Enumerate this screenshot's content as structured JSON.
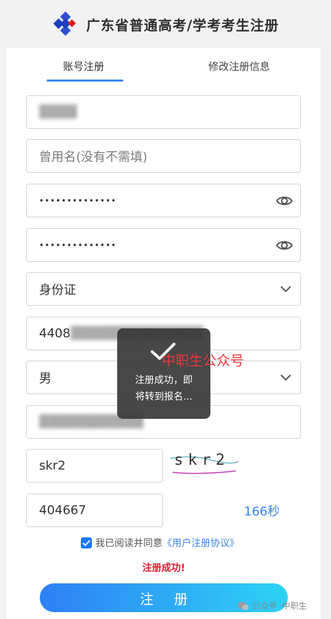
{
  "header": {
    "title": "广东省普通高考/学考考生注册"
  },
  "tabs": [
    {
      "label": "账号注册",
      "active": true
    },
    {
      "label": "修改注册信息",
      "active": false
    }
  ],
  "form": {
    "name_value": "▓▓▓▓",
    "former_name_placeholder": "曾用名(没有不需填)",
    "password_mask": "••••••••••••••",
    "confirm_password_mask": "••••••••••••••",
    "id_type": "身份证",
    "id_number_visible": "4408",
    "id_number_hidden": "▓▓▓▓▓▓▓▓▓▓▓▓▓▓",
    "gender": "男",
    "phone_hidden": "▓▓▓▓▓▓▓▓▓▓▓",
    "captcha_input": "skr2",
    "captcha_image_text": "skr2",
    "sms_code": "404667",
    "countdown": "166秒"
  },
  "agreement": {
    "prefix": "我已阅读并同意",
    "link": "《用户注册协议》",
    "checked": true
  },
  "status": {
    "message": "注册成功!"
  },
  "submit_label": "注册",
  "toast": {
    "line1": "注册成功，即",
    "line2": "将转到报名..."
  },
  "watermark": {
    "overlay": "中职生公众号",
    "footer_prefix": "公众号 · ",
    "footer_name": "中职生"
  },
  "colors": {
    "accent": "#3b86e6",
    "error": "#e0182d",
    "toast_bg": "#373737"
  }
}
